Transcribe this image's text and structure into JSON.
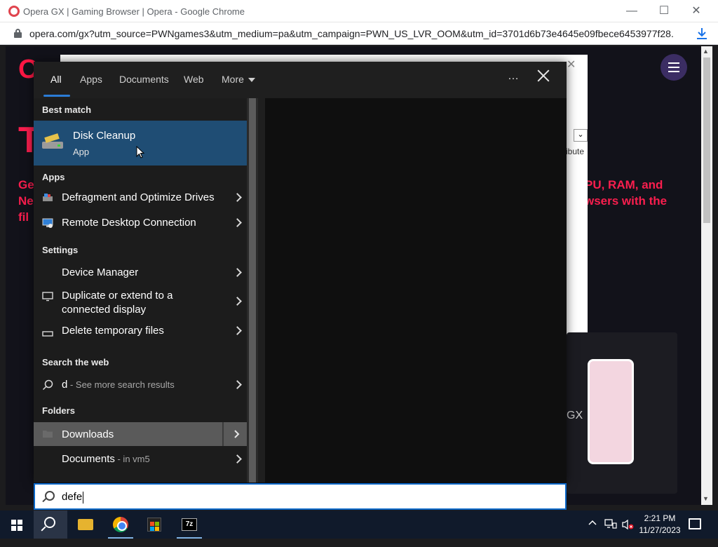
{
  "browser": {
    "title": "Opera GX | Gaming Browser | Opera - Google Chrome",
    "url": "opera.com/gx?utm_source=PWNgames3&utm_medium=pa&utm_campaign=PWN_US_LVR_OOM&utm_id=3701d6b73e4645e09fbece6453977f28...",
    "minimize": "—",
    "maximize": "☐",
    "close": "✕"
  },
  "page": {
    "logo": "O",
    "headline": "T",
    "line1_left": "Ge",
    "line1_right": "PU, RAM, and",
    "line2_left": "Ne",
    "line2_right": "wsers with the",
    "line3_left": "fil",
    "modal_text": "ribute",
    "mockup_text": "GX"
  },
  "search": {
    "tabs": [
      {
        "label": "All"
      },
      {
        "label": "Apps"
      },
      {
        "label": "Documents"
      },
      {
        "label": "Web"
      },
      {
        "label": "More"
      }
    ],
    "more_icon": "…",
    "best_match_header": "Best match",
    "best_match": {
      "title": "Disk Cleanup",
      "kind": "App"
    },
    "apps_header": "Apps",
    "apps": [
      {
        "label": "Defragment and Optimize Drives"
      },
      {
        "label": "Remote Desktop Connection"
      }
    ],
    "settings_header": "Settings",
    "settings": [
      {
        "label": "Device Manager"
      },
      {
        "label_line1": "Duplicate or extend to a",
        "label_line2": "connected display"
      },
      {
        "label": "Delete temporary files"
      }
    ],
    "web_header": "Search the web",
    "web": {
      "query": "d",
      "suffix": " - See more search results"
    },
    "folders_header": "Folders",
    "folders": [
      {
        "label": "Downloads"
      },
      {
        "label": "Documents",
        "suffix": " - in vm5"
      }
    ],
    "query": "defe"
  },
  "taskbar": {
    "time": "2:21 PM",
    "date": "11/27/2023",
    "zip_label": "7z"
  }
}
